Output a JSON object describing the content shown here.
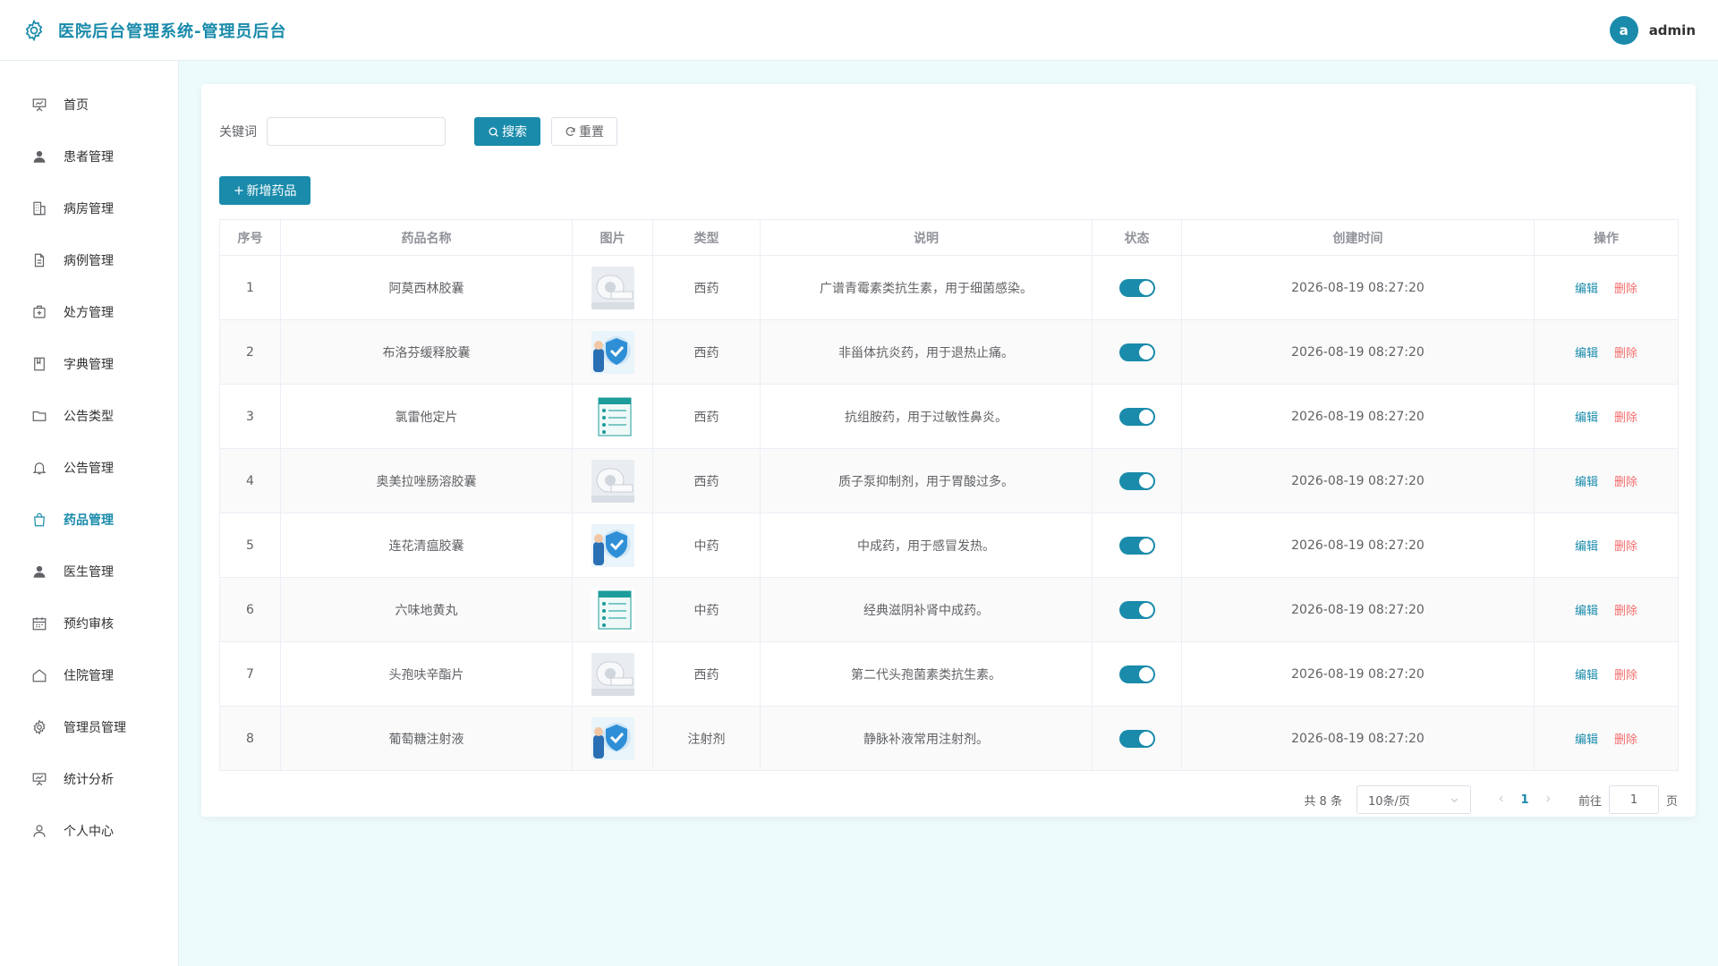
{
  "header": {
    "title": "医院后台管理系统-管理员后台",
    "avatar_letter": "a",
    "username": "admin"
  },
  "sidebar": {
    "items": [
      {
        "label": "首页",
        "icon": "presentation-icon"
      },
      {
        "label": "患者管理",
        "icon": "user-icon"
      },
      {
        "label": "病房管理",
        "icon": "building-icon"
      },
      {
        "label": "病例管理",
        "icon": "document-icon"
      },
      {
        "label": "处方管理",
        "icon": "medkit-icon"
      },
      {
        "label": "字典管理",
        "icon": "notebook-icon"
      },
      {
        "label": "公告类型",
        "icon": "folder-icon"
      },
      {
        "label": "公告管理",
        "icon": "bell-icon"
      },
      {
        "label": "药品管理",
        "icon": "bag-icon",
        "active": true
      },
      {
        "label": "医生管理",
        "icon": "user-icon"
      },
      {
        "label": "预约审核",
        "icon": "calendar-icon"
      },
      {
        "label": "住院管理",
        "icon": "house-icon"
      },
      {
        "label": "管理员管理",
        "icon": "gear-icon"
      },
      {
        "label": "统计分析",
        "icon": "presentation-icon"
      },
      {
        "label": "个人中心",
        "icon": "person-icon"
      }
    ]
  },
  "search": {
    "keyword_label": "关键词",
    "keyword_value": "",
    "search_label": "搜索",
    "reset_label": "重置"
  },
  "toolbar": {
    "add_label": "新增药品"
  },
  "table": {
    "columns": [
      "序号",
      "药品名称",
      "图片",
      "类型",
      "说明",
      "状态",
      "创建时间",
      "操作"
    ],
    "edit_label": "编辑",
    "delete_label": "删除",
    "rows": [
      {
        "no": "1",
        "name": "阿莫西林胶囊",
        "image": "scanner",
        "type": "西药",
        "desc": "广谱青霉素类抗生素，用于细菌感染。",
        "enabled": true,
        "created": "2026-08-19 08:27:20"
      },
      {
        "no": "2",
        "name": "布洛芬缓释胶囊",
        "image": "shield",
        "type": "西药",
        "desc": "非甾体抗炎药，用于退热止痛。",
        "enabled": true,
        "created": "2026-08-19 08:27:20"
      },
      {
        "no": "3",
        "name": "氯雷他定片",
        "image": "checklist",
        "type": "西药",
        "desc": "抗组胺药，用于过敏性鼻炎。",
        "enabled": true,
        "created": "2026-08-19 08:27:20"
      },
      {
        "no": "4",
        "name": "奥美拉唑肠溶胶囊",
        "image": "scanner",
        "type": "西药",
        "desc": "质子泵抑制剂，用于胃酸过多。",
        "enabled": true,
        "created": "2026-08-19 08:27:20"
      },
      {
        "no": "5",
        "name": "连花清瘟胶囊",
        "image": "shield",
        "type": "中药",
        "desc": "中成药，用于感冒发热。",
        "enabled": true,
        "created": "2026-08-19 08:27:20"
      },
      {
        "no": "6",
        "name": "六味地黄丸",
        "image": "checklist",
        "type": "中药",
        "desc": "经典滋阴补肾中成药。",
        "enabled": true,
        "created": "2026-08-19 08:27:20"
      },
      {
        "no": "7",
        "name": "头孢呋辛酯片",
        "image": "scanner",
        "type": "西药",
        "desc": "第二代头孢菌素类抗生素。",
        "enabled": true,
        "created": "2026-08-19 08:27:20"
      },
      {
        "no": "8",
        "name": "葡萄糖注射液",
        "image": "shield",
        "type": "注射剂",
        "desc": "静脉补液常用注射剂。",
        "enabled": true,
        "created": "2026-08-19 08:27:20"
      }
    ]
  },
  "pagination": {
    "total_label": "共 8 条",
    "page_size": "10条/页",
    "current_page": "1",
    "goto_label": "前往",
    "goto_value": "1",
    "page_suffix": "页"
  },
  "colors": {
    "primary": "#1a8bab",
    "danger": "#f56c6c",
    "background": "#eefbfd"
  }
}
